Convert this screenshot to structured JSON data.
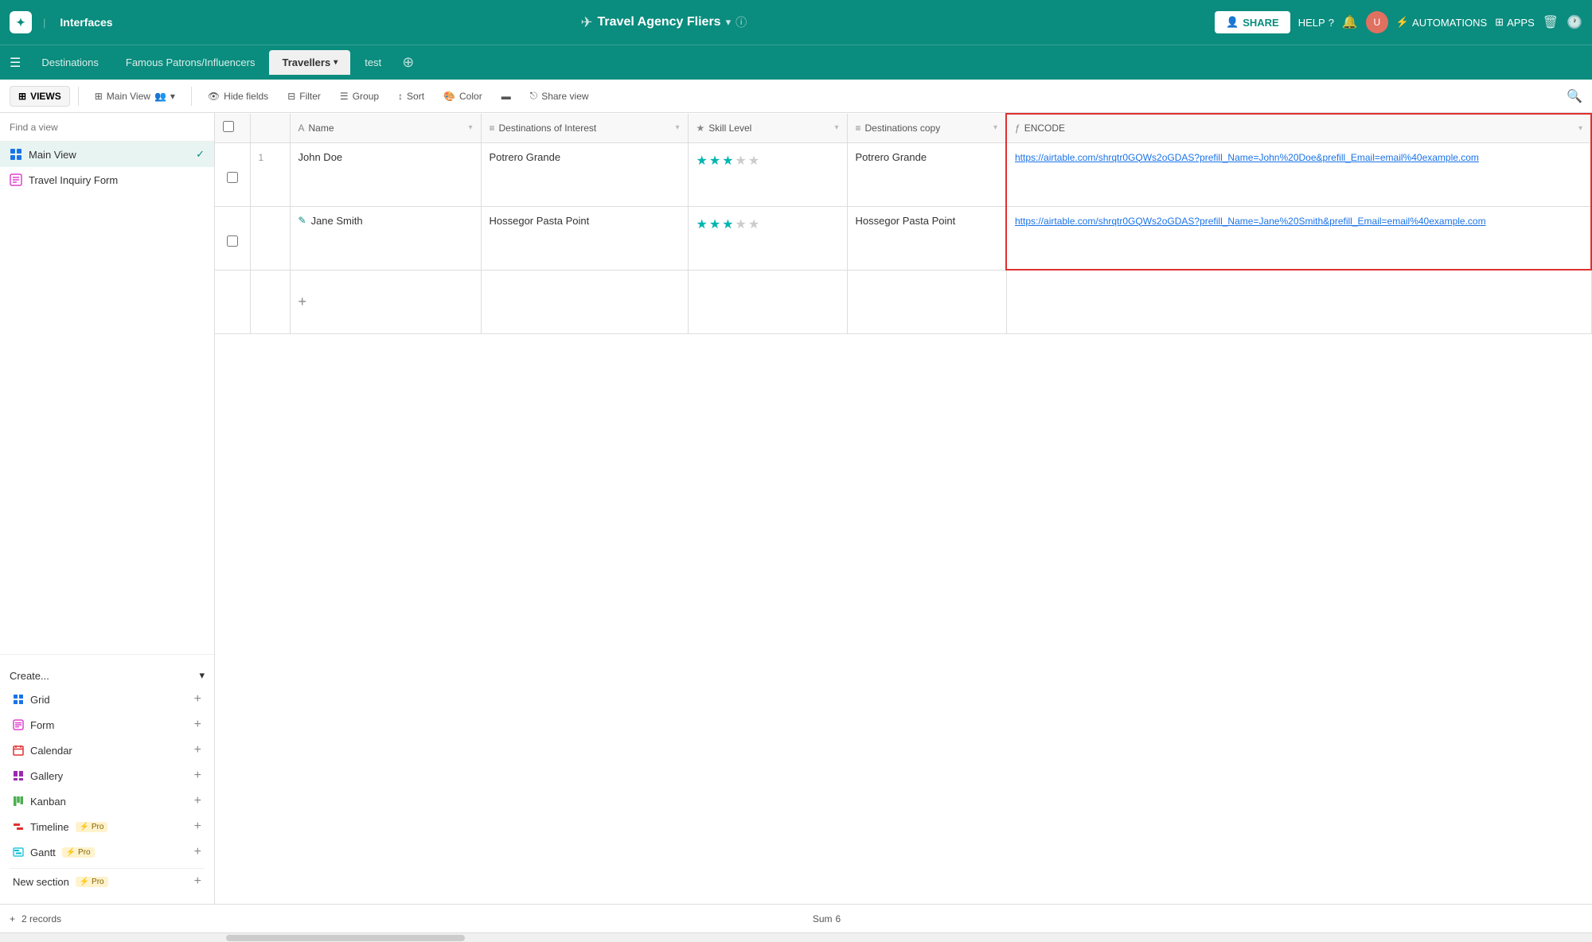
{
  "topNav": {
    "logo": "✦",
    "appTitle": "Interfaces",
    "dbTitle": "Travel Agency Fliers",
    "shareLabel": "SHARE",
    "helpLabel": "HELP",
    "automationsLabel": "AUTOMATIONS",
    "appsLabel": "APPS"
  },
  "tabs": [
    {
      "id": "destinations",
      "label": "Destinations",
      "active": false
    },
    {
      "id": "famous",
      "label": "Famous Patrons/Influencers",
      "active": false
    },
    {
      "id": "travellers",
      "label": "Travellers",
      "active": true,
      "hasArrow": true
    },
    {
      "id": "test",
      "label": "test",
      "active": false
    }
  ],
  "toolbar": {
    "views": "VIEWS",
    "mainView": "Main View",
    "hideFields": "Hide fields",
    "filter": "Filter",
    "group": "Group",
    "sort": "Sort",
    "color": "Color",
    "shareView": "Share view"
  },
  "sidebar": {
    "searchPlaceholder": "Find a view",
    "views": [
      {
        "id": "main-view",
        "label": "Main View",
        "type": "grid",
        "active": true
      },
      {
        "id": "travel-inquiry",
        "label": "Travel Inquiry Form",
        "type": "form",
        "active": false
      }
    ],
    "createLabel": "Create...",
    "createItems": [
      {
        "id": "grid",
        "label": "Grid",
        "type": "grid"
      },
      {
        "id": "form",
        "label": "Form",
        "type": "form"
      },
      {
        "id": "calendar",
        "label": "Calendar",
        "type": "calendar"
      },
      {
        "id": "gallery",
        "label": "Gallery",
        "type": "gallery"
      },
      {
        "id": "kanban",
        "label": "Kanban",
        "type": "kanban"
      },
      {
        "id": "timeline",
        "label": "Timeline",
        "type": "timeline",
        "pro": true
      },
      {
        "id": "gantt",
        "label": "Gantt",
        "type": "gantt",
        "pro": true
      }
    ],
    "newSectionLabel": "New section",
    "newSectionPro": true
  },
  "table": {
    "columns": [
      {
        "id": "checkbox",
        "label": "",
        "type": "checkbox"
      },
      {
        "id": "rownum",
        "label": "",
        "type": "rownum"
      },
      {
        "id": "name",
        "label": "Name",
        "type": "text",
        "icon": "A"
      },
      {
        "id": "destinations",
        "label": "Destinations of Interest",
        "type": "linked",
        "icon": "≡"
      },
      {
        "id": "skill",
        "label": "Skill Level",
        "type": "rating",
        "icon": "★"
      },
      {
        "id": "destcopy",
        "label": "Destinations copy",
        "type": "linked",
        "icon": "≡"
      },
      {
        "id": "encode",
        "label": "ENCODE",
        "type": "formula",
        "icon": "ƒ",
        "highlighted": true
      }
    ],
    "rows": [
      {
        "id": "1",
        "num": "1",
        "name": "John Doe",
        "destinations": "Potrero Grande",
        "skill": 3,
        "skillMax": 5,
        "destcopy": "Potrero Grande",
        "encode": "https://airtable.com/shrqtr0GQWs2oGDAS?prefill_Name=John%20Doe&prefill_Email=email%40example.com"
      },
      {
        "id": "2",
        "num": "",
        "name": "Jane Smith",
        "destinations": "Hossegor  Pasta Point",
        "skill": 3,
        "skillMax": 5,
        "destcopy": "Hossegor  Pasta Point",
        "encode": "https://airtable.com/shrqtr0GQWs2oGDAS?prefill_Name=Jane%20Smith&prefill_Email=email%40example.com"
      }
    ],
    "recordCount": "2 records",
    "sumLabel": "Sum",
    "sumValue": "6"
  }
}
